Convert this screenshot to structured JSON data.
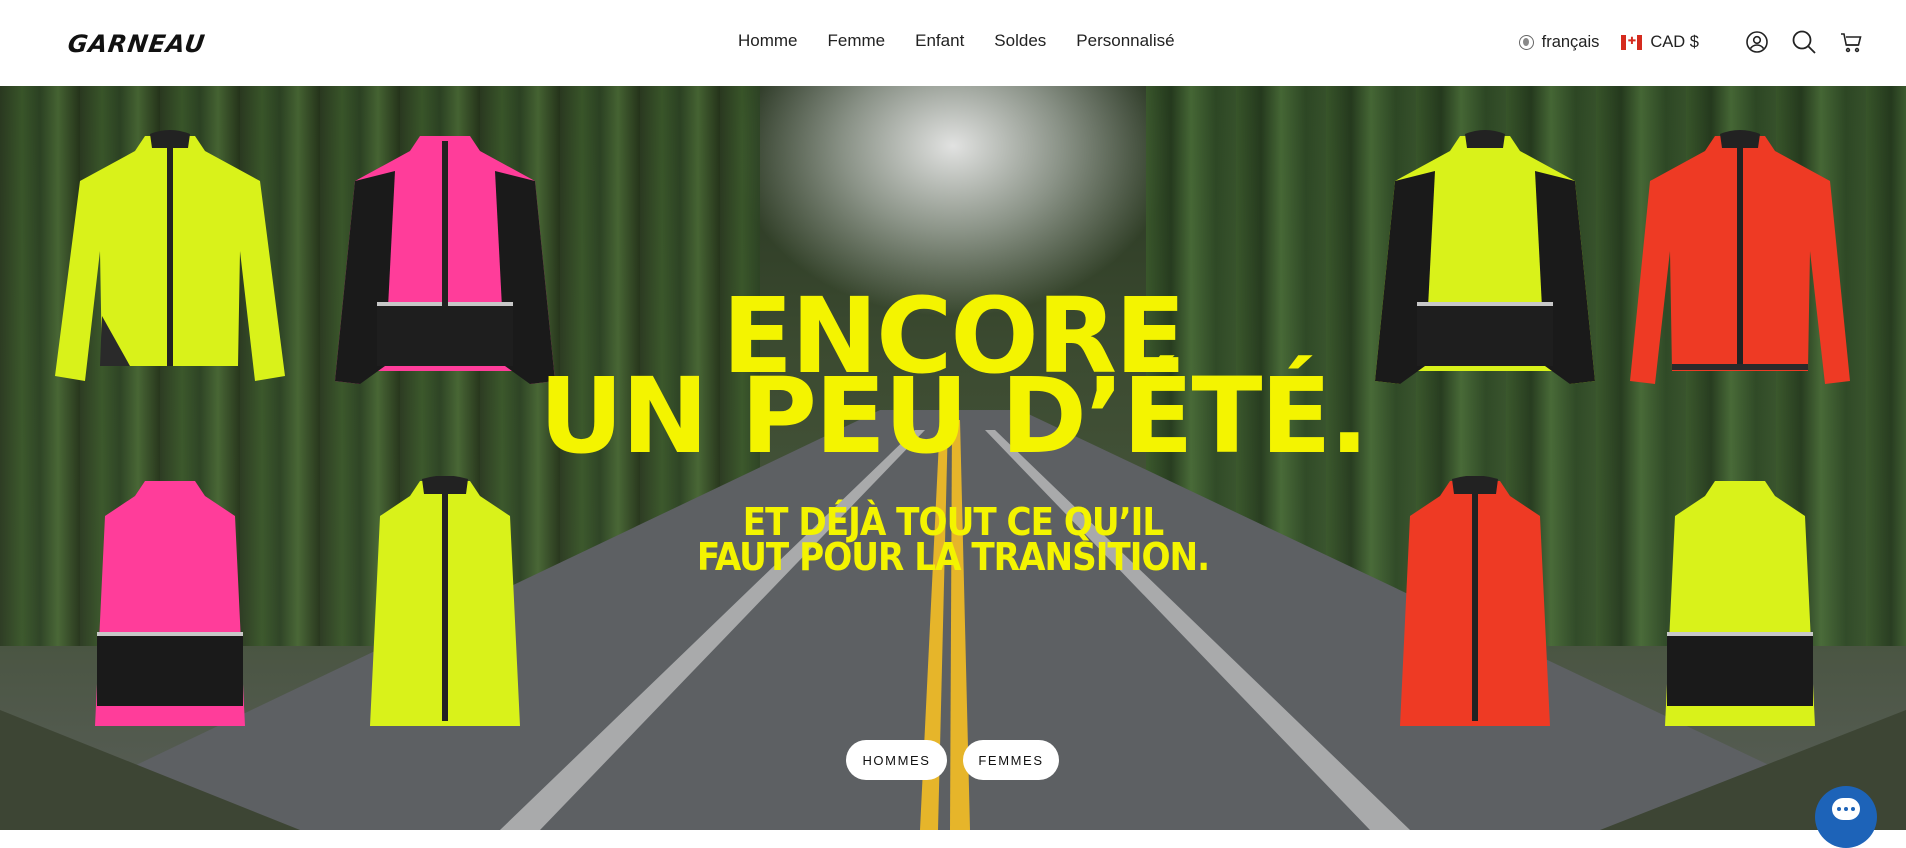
{
  "brand": {
    "logo_text": "GARNEAU"
  },
  "nav": {
    "items": [
      "Homme",
      "Femme",
      "Enfant",
      "Soldes",
      "Personnalisé"
    ]
  },
  "header_tools": {
    "language": "français",
    "currency": "CAD $",
    "icons": [
      "globe-icon",
      "flag-canada-icon",
      "account-icon",
      "search-icon",
      "cart-icon"
    ]
  },
  "hero": {
    "headline_line1": "ENCORE",
    "headline_line2": "UN PEU D’ÉTÉ.",
    "subline1": "ET DÉJÀ TOUT CE QU’IL",
    "subline2": "FAUT POUR LA TRANSITION.",
    "cta_men": "HOMMES",
    "cta_women": "FEMMES",
    "accent_color": "#f4f400"
  },
  "products": {
    "jacket_colors": [
      "#d9f21a",
      "#ff3d9a",
      "#d9f21a",
      "#ee3a24"
    ],
    "vest_colors": [
      "#ff3d9a",
      "#d9f21a",
      "#ee3a24",
      "#d9f21a"
    ]
  },
  "chat": {
    "icon": "chat-icon",
    "color": "#1d63b8"
  }
}
